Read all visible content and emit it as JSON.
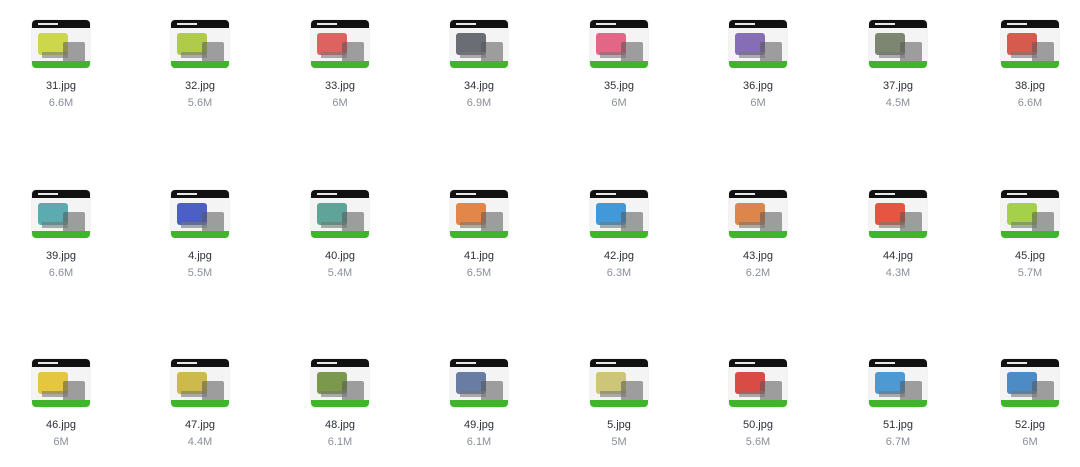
{
  "files": [
    {
      "name": "31.jpg",
      "size": "6.6M",
      "icon": "image-thumbnail-icon",
      "accent": "#c8d43a"
    },
    {
      "name": "32.jpg",
      "size": "5.6M",
      "icon": "image-thumbnail-icon",
      "accent": "#a9c63a"
    },
    {
      "name": "33.jpg",
      "size": "6M",
      "icon": "image-thumbnail-icon",
      "accent": "#d9534f"
    },
    {
      "name": "34.jpg",
      "size": "6.9M",
      "icon": "image-thumbnail-icon",
      "accent": "#5b5f66"
    },
    {
      "name": "35.jpg",
      "size": "6M",
      "icon": "image-thumbnail-icon",
      "accent": "#e0577a"
    },
    {
      "name": "36.jpg",
      "size": "6M",
      "icon": "image-thumbnail-icon",
      "accent": "#7a5fb0"
    },
    {
      "name": "37.jpg",
      "size": "4.5M",
      "icon": "image-thumbnail-icon",
      "accent": "#6f7a62"
    },
    {
      "name": "38.jpg",
      "size": "6.6M",
      "icon": "image-thumbnail-icon",
      "accent": "#d04a3c"
    },
    {
      "name": "39.jpg",
      "size": "6.6M",
      "icon": "image-thumbnail-icon",
      "accent": "#4aa3a8"
    },
    {
      "name": "4.jpg",
      "size": "5.5M",
      "icon": "image-thumbnail-icon",
      "accent": "#3a4fc0"
    },
    {
      "name": "40.jpg",
      "size": "5.4M",
      "icon": "image-thumbnail-icon",
      "accent": "#4f9a8f"
    },
    {
      "name": "41.jpg",
      "size": "6.5M",
      "icon": "image-thumbnail-icon",
      "accent": "#e07b36"
    },
    {
      "name": "42.jpg",
      "size": "6.3M",
      "icon": "image-thumbnail-icon",
      "accent": "#2f8fd6"
    },
    {
      "name": "43.jpg",
      "size": "6.2M",
      "icon": "image-thumbnail-icon",
      "accent": "#d97a3a"
    },
    {
      "name": "44.jpg",
      "size": "4.3M",
      "icon": "image-thumbnail-icon",
      "accent": "#e2452f"
    },
    {
      "name": "45.jpg",
      "size": "5.7M",
      "icon": "image-thumbnail-icon",
      "accent": "#9ccc3a"
    },
    {
      "name": "46.jpg",
      "size": "6M",
      "icon": "image-thumbnail-icon",
      "accent": "#e3c12c"
    },
    {
      "name": "47.jpg",
      "size": "4.4M",
      "icon": "image-thumbnail-icon",
      "accent": "#c9b43a"
    },
    {
      "name": "48.jpg",
      "size": "6.1M",
      "icon": "image-thumbnail-icon",
      "accent": "#6e8f3a"
    },
    {
      "name": "49.jpg",
      "size": "6.1M",
      "icon": "image-thumbnail-icon",
      "accent": "#5a6f9a"
    },
    {
      "name": "5.jpg",
      "size": "5M",
      "icon": "image-thumbnail-icon",
      "accent": "#c9c16a"
    },
    {
      "name": "50.jpg",
      "size": "5.6M",
      "icon": "image-thumbnail-icon",
      "accent": "#d63a33"
    },
    {
      "name": "51.jpg",
      "size": "6.7M",
      "icon": "image-thumbnail-icon",
      "accent": "#3a8fd0"
    },
    {
      "name": "52.jpg",
      "size": "6M",
      "icon": "image-thumbnail-icon",
      "accent": "#3a7fbf"
    }
  ],
  "colors": {
    "thumb_bottom": "#3fb52a",
    "name_text": "#2b2f36",
    "size_text": "#8a8f98"
  }
}
